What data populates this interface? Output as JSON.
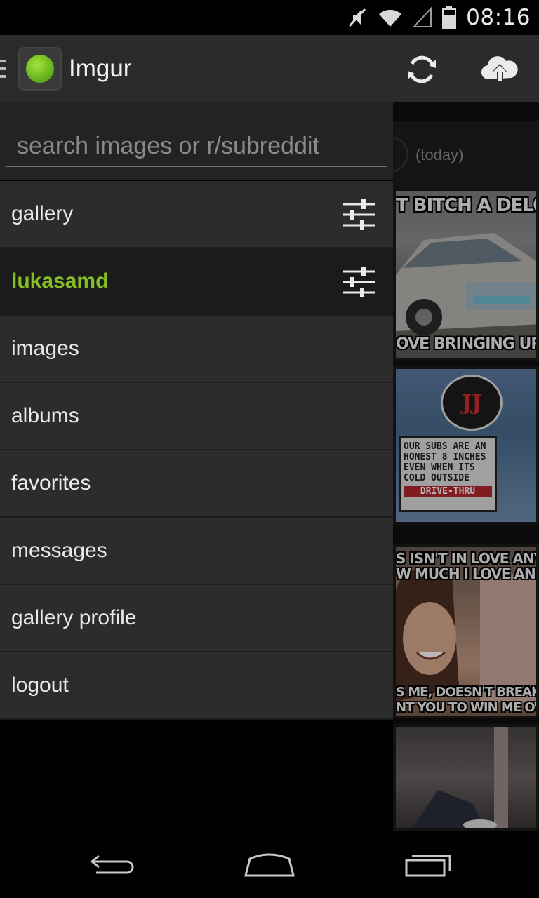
{
  "status_bar": {
    "time": "08:16",
    "icons": [
      "muted-icon",
      "wifi-icon",
      "signal-icon",
      "battery-icon"
    ]
  },
  "action_bar": {
    "title": "Imgur",
    "icons": [
      "drawer-indicator-icon",
      "imgur-logo",
      "refresh-icon",
      "upload-cloud-icon"
    ]
  },
  "drawer": {
    "search": {
      "value": "",
      "placeholder": "search images or r/subreddit"
    },
    "items": [
      {
        "label": "gallery",
        "has_filter": true,
        "active": false
      },
      {
        "label": "lukasamd",
        "has_filter": true,
        "active": true
      },
      {
        "label": "images",
        "has_filter": false,
        "active": false
      },
      {
        "label": "albums",
        "has_filter": false,
        "active": false
      },
      {
        "label": "favorites",
        "has_filter": false,
        "active": false
      },
      {
        "label": "messages",
        "has_filter": false,
        "active": false
      },
      {
        "label": "gallery profile",
        "has_filter": false,
        "active": false
      },
      {
        "label": "logout",
        "has_filter": false,
        "active": false
      }
    ]
  },
  "background_content": {
    "date_label": "(today)",
    "thumbnails": [
      {
        "top_text": "T BITCH A DELO",
        "bottom_text": "OVE BRINGING UP TH"
      },
      {
        "sign_lines": [
          "OUR SUBS ARE AN",
          "HONEST 8 INCHES",
          "EVEN WHEN ITS",
          "COLD OUTSIDE"
        ],
        "sign_footer": "DRIVE-THRU",
        "logo_text": "JJ"
      },
      {
        "top_text": "S ISN'T IN LOVE ANYMO",
        "top_text_2": "W MUCH I LOVE AND NE",
        "bottom_text": "S ME, DOESN'T BREAK UP, I",
        "bottom_text_2": "NT YOU TO WIN ME OVER A"
      },
      {}
    ]
  },
  "nav_bar": {
    "buttons": [
      "back-icon",
      "home-icon",
      "recent-apps-icon"
    ]
  },
  "colors": {
    "accent": "#85bf25",
    "drawer_item_bg": "#2c2c2c",
    "action_bar_bg": "#2b2b2b"
  }
}
